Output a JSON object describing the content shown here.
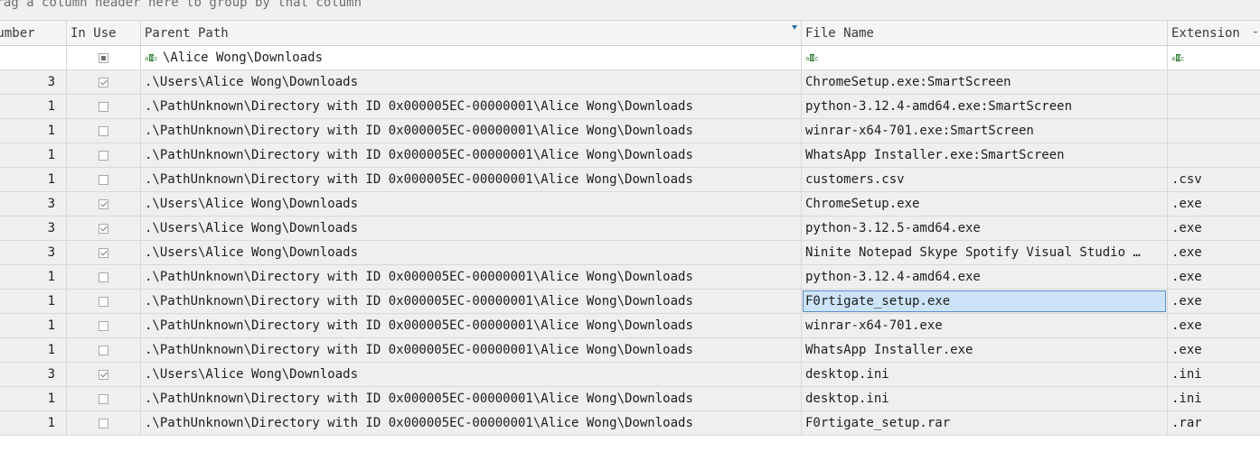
{
  "group_hint": "Drag a column header here to group by that column",
  "columns": {
    "number": "Number",
    "in_use": "In Use",
    "parent_path": "Parent Path",
    "file_name": "File Name",
    "extension": "Extension"
  },
  "filter_row": {
    "in_use_state": "indeterminate",
    "parent_path_filter": "\\Alice Wong\\Downloads",
    "file_name_filter": "",
    "extension_filter": "",
    "filter_icon": "text-filter-icon"
  },
  "rows": [
    {
      "number": "3",
      "in_use": true,
      "parent_path": ".\\Users\\Alice Wong\\Downloads",
      "file_name": "ChromeSetup.exe:SmartScreen",
      "extension": ""
    },
    {
      "number": "1",
      "in_use": false,
      "parent_path": ".\\PathUnknown\\Directory with ID 0x000005EC-00000001\\Alice Wong\\Downloads",
      "file_name": "python-3.12.4-amd64.exe:SmartScreen",
      "extension": ""
    },
    {
      "number": "1",
      "in_use": false,
      "parent_path": ".\\PathUnknown\\Directory with ID 0x000005EC-00000001\\Alice Wong\\Downloads",
      "file_name": "winrar-x64-701.exe:SmartScreen",
      "extension": ""
    },
    {
      "number": "1",
      "in_use": false,
      "parent_path": ".\\PathUnknown\\Directory with ID 0x000005EC-00000001\\Alice Wong\\Downloads",
      "file_name": "WhatsApp Installer.exe:SmartScreen",
      "extension": ""
    },
    {
      "number": "1",
      "in_use": false,
      "parent_path": ".\\PathUnknown\\Directory with ID 0x000005EC-00000001\\Alice Wong\\Downloads",
      "file_name": "customers.csv",
      "extension": ".csv"
    },
    {
      "number": "3",
      "in_use": true,
      "parent_path": ".\\Users\\Alice Wong\\Downloads",
      "file_name": "ChromeSetup.exe",
      "extension": ".exe"
    },
    {
      "number": "3",
      "in_use": true,
      "parent_path": ".\\Users\\Alice Wong\\Downloads",
      "file_name": "python-3.12.5-amd64.exe",
      "extension": ".exe"
    },
    {
      "number": "3",
      "in_use": true,
      "parent_path": ".\\Users\\Alice Wong\\Downloads",
      "file_name": "Ninite Notepad Skype Spotify Visual Studio …",
      "extension": ".exe"
    },
    {
      "number": "1",
      "in_use": false,
      "parent_path": ".\\PathUnknown\\Directory with ID 0x000005EC-00000001\\Alice Wong\\Downloads",
      "file_name": "python-3.12.4-amd64.exe",
      "extension": ".exe"
    },
    {
      "number": "1",
      "in_use": false,
      "parent_path": ".\\PathUnknown\\Directory with ID 0x000005EC-00000001\\Alice Wong\\Downloads",
      "file_name": "F0rtigate_setup.exe",
      "extension": ".exe",
      "selected": true
    },
    {
      "number": "1",
      "in_use": false,
      "parent_path": ".\\PathUnknown\\Directory with ID 0x000005EC-00000001\\Alice Wong\\Downloads",
      "file_name": "winrar-x64-701.exe",
      "extension": ".exe"
    },
    {
      "number": "1",
      "in_use": false,
      "parent_path": ".\\PathUnknown\\Directory with ID 0x000005EC-00000001\\Alice Wong\\Downloads",
      "file_name": "WhatsApp Installer.exe",
      "extension": ".exe"
    },
    {
      "number": "3",
      "in_use": true,
      "parent_path": ".\\Users\\Alice Wong\\Downloads",
      "file_name": "desktop.ini",
      "extension": ".ini"
    },
    {
      "number": "1",
      "in_use": false,
      "parent_path": ".\\PathUnknown\\Directory with ID 0x000005EC-00000001\\Alice Wong\\Downloads",
      "file_name": "desktop.ini",
      "extension": ".ini"
    },
    {
      "number": "1",
      "in_use": false,
      "parent_path": ".\\PathUnknown\\Directory with ID 0x000005EC-00000001\\Alice Wong\\Downloads",
      "file_name": "F0rtigate_setup.rar",
      "extension": ".rar"
    }
  ]
}
